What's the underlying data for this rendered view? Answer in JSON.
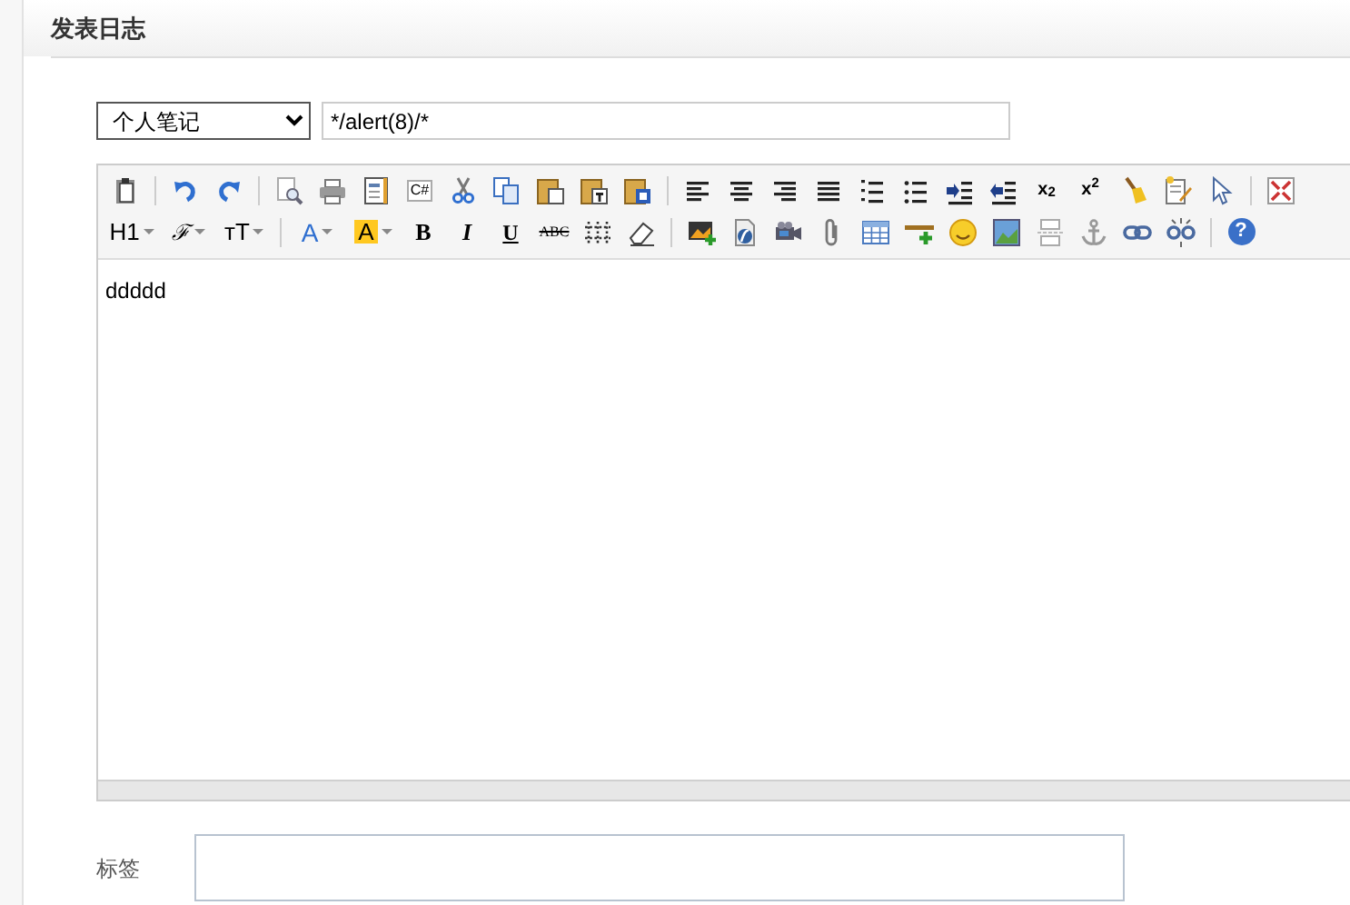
{
  "header": {
    "title": "发表日志"
  },
  "category": {
    "value": "个人笔记"
  },
  "title_field": {
    "value": "*/alert(8)/*"
  },
  "editor": {
    "toolbar_rows": [
      [
        {
          "kind": "clipboard"
        },
        {
          "kind": "sep"
        },
        {
          "kind": "undo"
        },
        {
          "kind": "redo"
        },
        {
          "kind": "sep"
        },
        {
          "kind": "preview"
        },
        {
          "kind": "print"
        },
        {
          "kind": "template"
        },
        {
          "kind": "code",
          "label": "C#"
        },
        {
          "kind": "cut"
        },
        {
          "kind": "copy"
        },
        {
          "kind": "paste"
        },
        {
          "kind": "paste-text"
        },
        {
          "kind": "paste-word"
        },
        {
          "kind": "sep"
        },
        {
          "kind": "align-left"
        },
        {
          "kind": "align-center"
        },
        {
          "kind": "align-right"
        },
        {
          "kind": "justify"
        },
        {
          "kind": "ordered-list"
        },
        {
          "kind": "bullet-list"
        },
        {
          "kind": "indent"
        },
        {
          "kind": "outdent"
        },
        {
          "kind": "subscript",
          "label": "x$_{2}$"
        },
        {
          "kind": "superscript",
          "label": "x$^{2}$"
        },
        {
          "kind": "broom"
        },
        {
          "kind": "edit"
        },
        {
          "kind": "select"
        },
        {
          "kind": "sep"
        },
        {
          "kind": "fullscreen"
        }
      ],
      [
        {
          "kind": "heading",
          "label": "H1"
        },
        {
          "kind": "font-family",
          "label": "ℱ"
        },
        {
          "kind": "font-size",
          "label": "ᴛT"
        },
        {
          "kind": "sep"
        },
        {
          "kind": "fore-color",
          "label": "A"
        },
        {
          "kind": "back-color",
          "label": "A"
        },
        {
          "kind": "bold",
          "label": "B"
        },
        {
          "kind": "italic",
          "label": "I"
        },
        {
          "kind": "underline",
          "label": "U"
        },
        {
          "kind": "strike",
          "label": "ABC"
        },
        {
          "kind": "dotted-rule"
        },
        {
          "kind": "eraser"
        },
        {
          "kind": "sep"
        },
        {
          "kind": "image"
        },
        {
          "kind": "flash"
        },
        {
          "kind": "video"
        },
        {
          "kind": "attach"
        },
        {
          "kind": "table"
        },
        {
          "kind": "rule"
        },
        {
          "kind": "emoticon"
        },
        {
          "kind": "map"
        },
        {
          "kind": "pagebreak"
        },
        {
          "kind": "anchor"
        },
        {
          "kind": "link"
        },
        {
          "kind": "unlink"
        },
        {
          "kind": "sep"
        },
        {
          "kind": "help",
          "label": "?"
        }
      ]
    ],
    "content": "ddddd"
  },
  "tags": {
    "label": "标签"
  }
}
